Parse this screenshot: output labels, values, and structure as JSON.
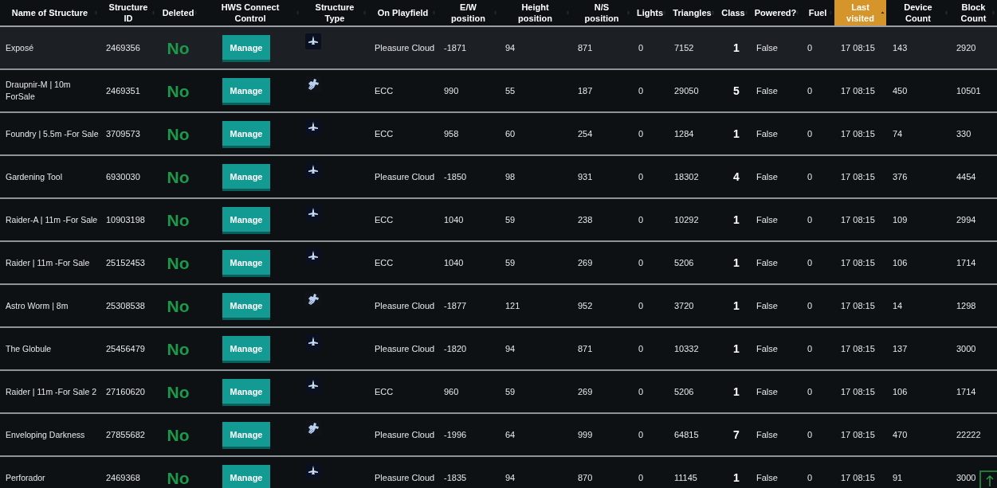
{
  "table": {
    "columns": [
      {
        "label": "Name of Structure",
        "sorted": false
      },
      {
        "label": "Structure ID",
        "sorted": false
      },
      {
        "label": "Deleted",
        "sorted": false
      },
      {
        "label": "HWS Connect Control",
        "sorted": false
      },
      {
        "label": "Structure Type",
        "sorted": false
      },
      {
        "label": "On Playfield",
        "sorted": false
      },
      {
        "label": "E/W position",
        "sorted": false
      },
      {
        "label": "Height position",
        "sorted": false
      },
      {
        "label": "N/S position",
        "sorted": false
      },
      {
        "label": "Lights",
        "sorted": false
      },
      {
        "label": "Triangles",
        "sorted": false
      },
      {
        "label": "Class",
        "sorted": false
      },
      {
        "label": "Powered?",
        "sorted": false
      },
      {
        "label": "Fuel",
        "sorted": false
      },
      {
        "label": "Last visited",
        "sorted": true
      },
      {
        "label": "Device Count",
        "sorted": false
      },
      {
        "label": "Block Count",
        "sorted": false
      }
    ],
    "rows": [
      {
        "selected": true,
        "cells": [
          "Exposé",
          "2469356",
          "No",
          "Manage",
          {
            "kind": "small"
          },
          "Pleasure Cloud",
          "-1871",
          "94",
          "871",
          "0",
          "7152",
          "1",
          "False",
          "0",
          "17 08:15",
          "143",
          "2920"
        ]
      },
      {
        "selected": false,
        "cells": [
          "Draupnir-M | 10m ForSale",
          "2469351",
          "No",
          "Manage",
          {
            "kind": "capital"
          },
          "ECC",
          "990",
          "55",
          "187",
          "0",
          "29050",
          "5",
          "False",
          "0",
          "17 08:15",
          "450",
          "10501"
        ]
      },
      {
        "selected": false,
        "cells": [
          "Foundry | 5.5m -For Sale",
          "3709573",
          "No",
          "Manage",
          {
            "kind": "small"
          },
          "ECC",
          "958",
          "60",
          "254",
          "0",
          "1284",
          "1",
          "False",
          "0",
          "17 08:15",
          "74",
          "330"
        ]
      },
      {
        "selected": false,
        "cells": [
          "Gardening Tool",
          "6930030",
          "No",
          "Manage",
          {
            "kind": "small"
          },
          "Pleasure Cloud",
          "-1850",
          "98",
          "931",
          "0",
          "18302",
          "4",
          "False",
          "0",
          "17 08:15",
          "376",
          "4454"
        ]
      },
      {
        "selected": false,
        "cells": [
          "Raider-A | 11m -For Sale",
          "10903198",
          "No",
          "Manage",
          {
            "kind": "small"
          },
          "ECC",
          "1040",
          "59",
          "238",
          "0",
          "10292",
          "1",
          "False",
          "0",
          "17 08:15",
          "109",
          "2994"
        ]
      },
      {
        "selected": false,
        "cells": [
          "Raider | 11m -For Sale",
          "25152453",
          "No",
          "Manage",
          {
            "kind": "small"
          },
          "ECC",
          "1040",
          "59",
          "269",
          "0",
          "5206",
          "1",
          "False",
          "0",
          "17 08:15",
          "106",
          "1714"
        ]
      },
      {
        "selected": false,
        "cells": [
          "Astro Worm | 8m",
          "25308538",
          "No",
          "Manage",
          {
            "kind": "capital"
          },
          "Pleasure Cloud",
          "-1877",
          "121",
          "952",
          "0",
          "3720",
          "1",
          "False",
          "0",
          "17 08:15",
          "14",
          "1298"
        ]
      },
      {
        "selected": false,
        "cells": [
          "The Globule",
          "25456479",
          "No",
          "Manage",
          {
            "kind": "small"
          },
          "Pleasure Cloud",
          "-1820",
          "94",
          "871",
          "0",
          "10332",
          "1",
          "False",
          "0",
          "17 08:15",
          "137",
          "3000"
        ]
      },
      {
        "selected": false,
        "cells": [
          "Raider | 11m -For Sale 2",
          "27160620",
          "No",
          "Manage",
          {
            "kind": "small"
          },
          "ECC",
          "960",
          "59",
          "269",
          "0",
          "5206",
          "1",
          "False",
          "0",
          "17 08:15",
          "106",
          "1714"
        ]
      },
      {
        "selected": false,
        "cells": [
          "Enveloping Darkness",
          "27855682",
          "No",
          "Manage",
          {
            "kind": "capital"
          },
          "Pleasure Cloud",
          "-1996",
          "64",
          "999",
          "0",
          "64815",
          "7",
          "False",
          "0",
          "17 08:15",
          "470",
          "22222"
        ]
      },
      {
        "selected": false,
        "cells": [
          "Perforador",
          "2469368",
          "No",
          "Manage",
          {
            "kind": "small"
          },
          "Pleasure Cloud",
          "-1835",
          "94",
          "870",
          "0",
          "11145",
          "1",
          "False",
          "0",
          "17 08:15",
          "91",
          "3000"
        ]
      }
    ]
  }
}
